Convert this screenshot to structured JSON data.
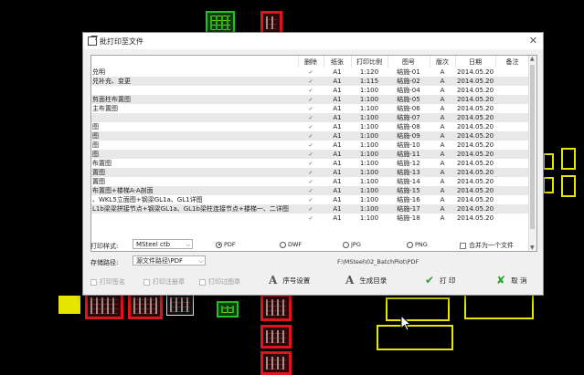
{
  "dialog": {
    "title": "批打印至文件",
    "close_glyph": "✕"
  },
  "table": {
    "headers": [
      "",
      "删除",
      "纸张",
      "打印比例",
      "图号",
      "版次",
      "日期",
      "备注"
    ],
    "rows": [
      {
        "name": "兑明",
        "del": "✓",
        "paper": "A1",
        "scale": "1:120",
        "num": "结施-01",
        "rev": "A",
        "date": "2014.05.20"
      },
      {
        "name": "兑补充、变更",
        "del": "✓",
        "paper": "A1",
        "scale": "1:115",
        "num": "结施-02",
        "rev": "A",
        "date": "2014.05.20"
      },
      {
        "name": "",
        "del": "✓",
        "paper": "A1",
        "scale": "1:100",
        "num": "结施-04",
        "rev": "A",
        "date": "2014.05.20"
      },
      {
        "name": "剪面柱布置图",
        "del": "✓",
        "paper": "A1",
        "scale": "1:100",
        "num": "结施-05",
        "rev": "A",
        "date": "2014.05.20"
      },
      {
        "name": "主布置图",
        "del": "✓",
        "paper": "A1",
        "scale": "1:100",
        "num": "结施-06",
        "rev": "A",
        "date": "2014.05.20"
      },
      {
        "name": "",
        "del": "✓",
        "paper": "A1",
        "scale": "1:100",
        "num": "结施-07",
        "rev": "A",
        "date": "2014.05.20"
      },
      {
        "name": "图",
        "del": "✓",
        "paper": "A1",
        "scale": "1:100",
        "num": "结施-08",
        "rev": "A",
        "date": "2014.05.20"
      },
      {
        "name": "图",
        "del": "✓",
        "paper": "A1",
        "scale": "1:100",
        "num": "结施-09",
        "rev": "A",
        "date": "2014.05.20"
      },
      {
        "name": "图",
        "del": "✓",
        "paper": "A1",
        "scale": "1:100",
        "num": "结施-10",
        "rev": "A",
        "date": "2014.05.20"
      },
      {
        "name": "图",
        "del": "✓",
        "paper": "A1",
        "scale": "1:100",
        "num": "结施-11",
        "rev": "A",
        "date": "2014.05.20"
      },
      {
        "name": "布置图",
        "del": "✓",
        "paper": "A1",
        "scale": "1:100",
        "num": "结施-12",
        "rev": "A",
        "date": "2014.05.20"
      },
      {
        "name": "置图",
        "del": "✓",
        "paper": "A1",
        "scale": "1:100",
        "num": "结施-13",
        "rev": "A",
        "date": "2014.05.20"
      },
      {
        "name": "置图",
        "del": "✓",
        "paper": "A1",
        "scale": "1:100",
        "num": "结施-14",
        "rev": "A",
        "date": "2014.05.20"
      },
      {
        "name": "布置图+楼梯A-A剖面",
        "del": "✓",
        "paper": "A1",
        "scale": "1:100",
        "num": "结施-15",
        "rev": "A",
        "date": "2014.05.20"
      },
      {
        "name": "、WKL5立面图+钢梁GL1a、GL1详图",
        "del": "✓",
        "paper": "A1",
        "scale": "1:100",
        "num": "结施-16",
        "rev": "A",
        "date": "2014.05.20"
      },
      {
        "name": "L1b梁梁拼接节点+钢梁GL1a、GL1b梁柱连接节点+楼梯一、二详图",
        "del": "✓",
        "paper": "A1",
        "scale": "1:100",
        "num": "结施-17",
        "rev": "A",
        "date": "2014.05.20"
      },
      {
        "name": "",
        "del": "✓",
        "paper": "A1",
        "scale": "1:100",
        "num": "结施-18",
        "rev": "A",
        "date": "2014.05.20"
      }
    ]
  },
  "print_style": {
    "label": "打印样式:",
    "value": "MSteel ctb"
  },
  "formats": [
    {
      "label": "PDF",
      "selected": true
    },
    {
      "label": "DWF",
      "selected": false
    },
    {
      "label": "JPG",
      "selected": false
    },
    {
      "label": "PNG",
      "selected": false
    }
  ],
  "merge_checkbox": {
    "label": "合并为一个文件"
  },
  "save_path": {
    "label": "存储路径:",
    "value": "源文件路径\\PDF",
    "path_text": "F:\\MSteel\\02_BatchPlot\\PDF"
  },
  "options": [
    {
      "label": "打印签名"
    },
    {
      "label": "打印注册章"
    },
    {
      "label": "打印过图章"
    }
  ],
  "buttons": {
    "sequence": "序号设置",
    "generate": "生成目录",
    "print": "打 印",
    "cancel": "取 消",
    "a_glyph": "A",
    "ok_glyph": "✔",
    "x_glyph": "✘"
  },
  "colors": {
    "cad_red": "#e0141e",
    "cad_yellow": "#e6e600",
    "cad_green": "#22c322",
    "dialog_bg": "#f0f0f0"
  }
}
